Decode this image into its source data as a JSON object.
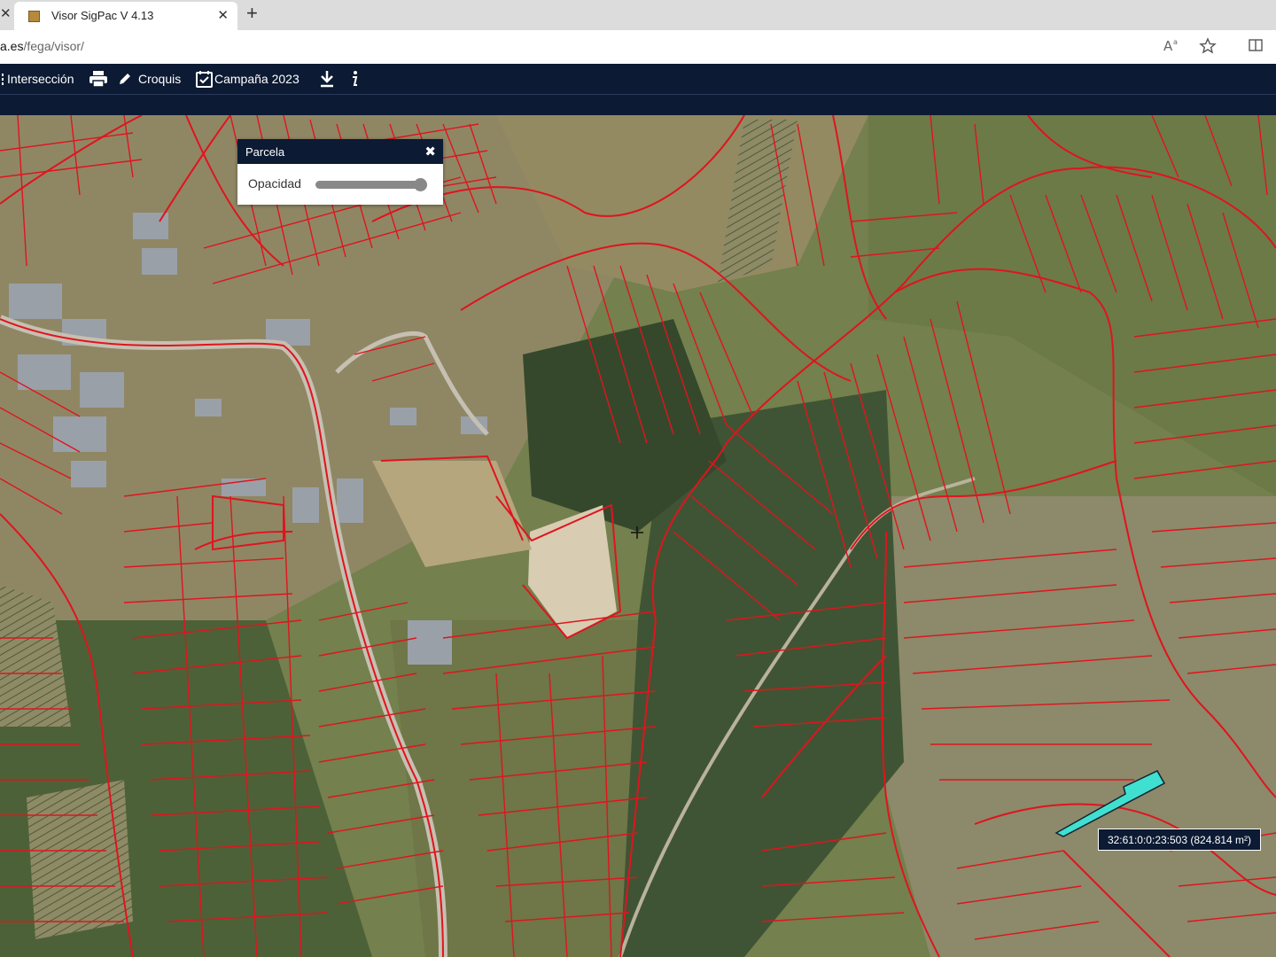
{
  "browser": {
    "tab_title": "Visor SigPac V 4.13",
    "url_host": "a.es",
    "url_path": "/fega/visor/"
  },
  "toolbar": {
    "interseccion_label": "Intersección",
    "croquis_label": "Croquis",
    "campana_label": "Campaña 2023"
  },
  "panel": {
    "title": "Parcela",
    "opacity_label": "Opacidad",
    "opacity_value": 1.0
  },
  "selected_parcel": {
    "label": "32:61:0:0:23:503 (824.814 m²)",
    "highlight_color": "#40e0d0"
  },
  "colors": {
    "toolbar_bg": "#0c1a33",
    "parcel_border": "#e0141e"
  }
}
